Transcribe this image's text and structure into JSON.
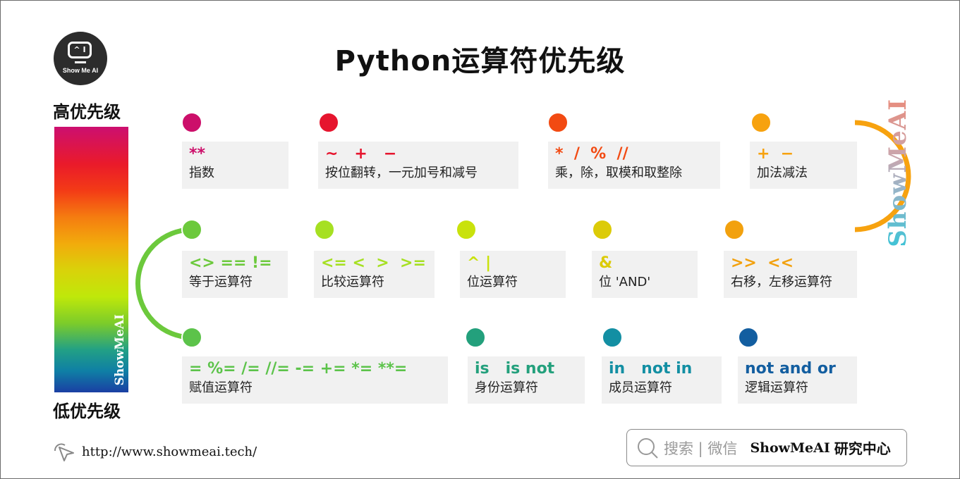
{
  "page": {
    "title": "Python运算符优先级",
    "logo_text": "Show Me AI",
    "logo_screen": "^ I"
  },
  "legend": {
    "high_label": "高优先级",
    "low_label": "低优先级",
    "gradient_watermark": "ShowMeAI",
    "side_watermark": "ShowMeAI",
    "gradient_colors": [
      "#cc0f70",
      "#ea1a2a",
      "#f57c10",
      "#d9d20a",
      "#bfe80a",
      "#7ccc2a",
      "#22a085",
      "#1a3fa3"
    ]
  },
  "levels": [
    {
      "rank": 1,
      "ops": "**",
      "desc": "指数",
      "color": "#cc0f6a"
    },
    {
      "rank": 2,
      "ops": "~   +   −",
      "desc": "按位翻转，一元加号和减号",
      "color": "#e6152e"
    },
    {
      "rank": 3,
      "ops": "*  /  %  //",
      "desc": "乘，除，取模和取整除",
      "color": "#f24a12"
    },
    {
      "rank": 4,
      "ops": "+  −",
      "desc": "加法减法",
      "color": "#f7a20f"
    },
    {
      "rank": 5,
      "ops": ">>  <<",
      "desc": "右移，左移运算符",
      "color": "#f2a10e"
    },
    {
      "rank": 6,
      "ops": "&",
      "desc": "位 'AND'",
      "color": "#dccb08"
    },
    {
      "rank": 7,
      "ops": "^ |",
      "desc": "位运算符",
      "color": "#c9e20c"
    },
    {
      "rank": 8,
      "ops": "<= <  >  >=",
      "desc": "比较运算符",
      "color": "#a6e022"
    },
    {
      "rank": 9,
      "ops": "<> == !=",
      "desc": "等于运算符",
      "color": "#6cc93c"
    },
    {
      "rank": 10,
      "ops": "= %= /= //= -= += *= **=",
      "desc": "赋值运算符",
      "color": "#5cc34a"
    },
    {
      "rank": 11,
      "ops": "is   is not",
      "desc": "身份运算符",
      "color": "#23a07c"
    },
    {
      "rank": 12,
      "ops": "in   not in",
      "desc": "成员运算符",
      "color": "#138fa3"
    },
    {
      "rank": 13,
      "ops": "not and or",
      "desc": "逻辑运算符",
      "color": "#135ea0"
    }
  ],
  "footer": {
    "url": "http://www.showmeai.tech/",
    "search_hint": "搜索 | 微信",
    "search_brand": "ShowMeAI",
    "search_suffix": "研究中心"
  }
}
